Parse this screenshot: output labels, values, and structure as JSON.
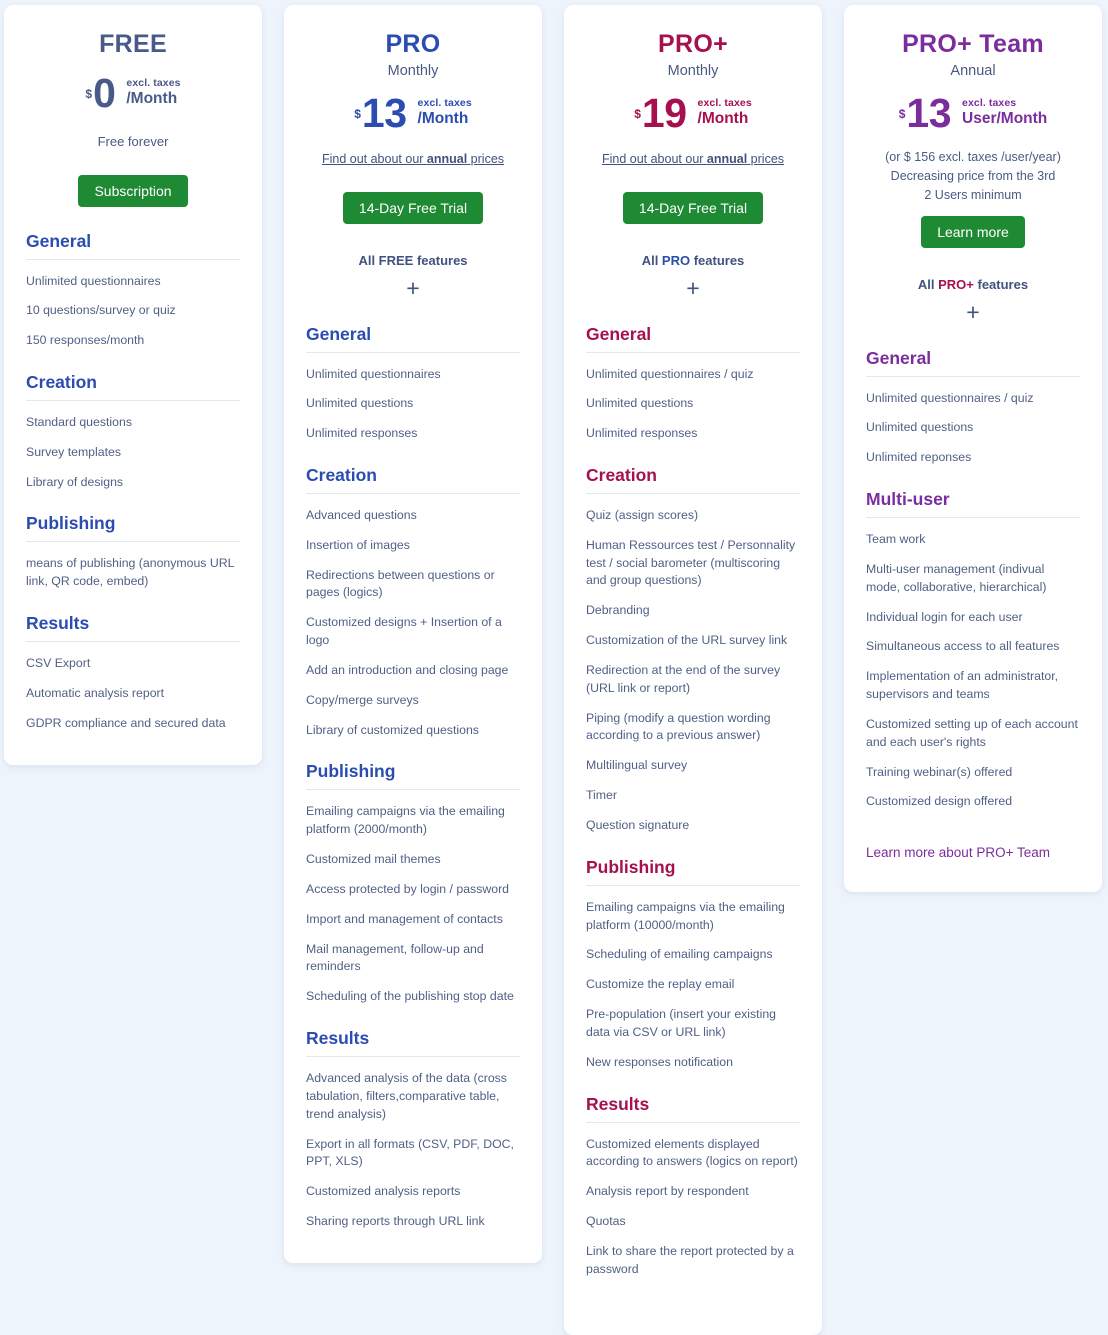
{
  "page": {
    "background": "#eef4fb",
    "card_background": "#ffffff",
    "body_text_color": "#505f85",
    "cta_green": "#1f8a34"
  },
  "plans": [
    {
      "id": "free",
      "name": "FREE",
      "period": "",
      "accent": "#4a5a88",
      "heading_color": "#2b4cb0",
      "price": {
        "currency": "$",
        "amount": "0",
        "tax_note": "excl. taxes",
        "per": "/Month"
      },
      "subnote": "Free forever",
      "cta_label": "Subscription",
      "sections": [
        {
          "title": "General",
          "items": [
            "Unlimited questionnaires",
            "10 questions/survey or quiz",
            "150 responses/month"
          ]
        },
        {
          "title": "Creation",
          "items": [
            "Standard questions",
            "Survey templates",
            "Library of designs"
          ]
        },
        {
          "title": "Publishing",
          "items": [
            "means of publishing (anonymous URL link, QR code, embed)"
          ]
        },
        {
          "title": "Results",
          "items": [
            "CSV Export",
            "Automatic analysis report",
            "GDPR compliance and secured data"
          ]
        }
      ]
    },
    {
      "id": "pro",
      "name": "PRO",
      "period": "Monthly",
      "accent": "#2b4cb0",
      "heading_color": "#2b4cb0",
      "price": {
        "currency": "$",
        "amount": "13",
        "tax_note": "excl. taxes",
        "per": "/Month"
      },
      "annual_link": {
        "before": "Find out about our ",
        "bold": "annual",
        "after": " prices"
      },
      "cta_label": "14-Day Free Trial",
      "includes": {
        "prefix": "All ",
        "highlight": "FREE",
        "suffix": " features",
        "highlight_color": "#41527e"
      },
      "plus": "+",
      "sections": [
        {
          "title": "General",
          "items": [
            "Unlimited questionnaires",
            "Unlimited questions",
            "Unlimited responses"
          ]
        },
        {
          "title": "Creation",
          "items": [
            "Advanced questions",
            "Insertion of images",
            "Redirections between questions or pages (logics)",
            "Customized designs + Insertion of a logo",
            "Add an introduction and closing page",
            "Copy/merge surveys",
            "Library of customized questions"
          ]
        },
        {
          "title": "Publishing",
          "items": [
            "Emailing campaigns via the emailing platform (2000/month)",
            "Customized mail themes",
            "Access protected by login / password",
            "Import and management of contacts",
            "Mail management, follow-up and reminders",
            "Scheduling of the publishing stop date"
          ]
        },
        {
          "title": "Results",
          "items": [
            "Advanced analysis of the data (cross tabulation, filters,comparative table, trend analysis)",
            "Export in all formats (CSV, PDF, DOC, PPT, XLS)",
            "Customized analysis reports",
            "Sharing reports through URL link"
          ]
        }
      ]
    },
    {
      "id": "proplus",
      "name": "PRO+",
      "period": "Monthly",
      "accent": "#a6104f",
      "heading_color": "#a6104f",
      "price": {
        "currency": "$",
        "amount": "19",
        "tax_note": "excl. taxes",
        "per": "/Month"
      },
      "annual_link": {
        "before": "Find out about our ",
        "bold": "annual",
        "after": " prices"
      },
      "cta_label": "14-Day Free Trial",
      "includes": {
        "prefix": "All ",
        "highlight": "PRO",
        "suffix": " features",
        "highlight_color": "#2b4cb0"
      },
      "plus": "+",
      "sections": [
        {
          "title": "General",
          "items": [
            "Unlimited questionnaires / quiz",
            "Unlimited questions",
            "Unlimited responses"
          ]
        },
        {
          "title": "Creation",
          "items": [
            "Quiz (assign scores)",
            "Human Ressources test / Personnality test / social barometer (multiscoring and group questions)",
            "Debranding",
            "Customization of the URL survey link",
            "Redirection at the end of the survey (URL link or report)",
            "Piping (modify a question wording according to a previous answer)",
            "Multilingual survey",
            "Timer",
            "Question signature"
          ]
        },
        {
          "title": "Publishing",
          "items": [
            "Emailing campaigns via the emailing platform (10000/month)",
            "Scheduling of emailing campaigns",
            "Customize the replay email",
            "Pre-population (insert your existing data via CSV or URL link)",
            "New responses notification"
          ]
        },
        {
          "title": "Results",
          "items": [
            "Customized elements displayed according to answers (logics on report)",
            "Analysis report by respondent",
            "Quotas",
            "Link to share the report protected by a password"
          ]
        }
      ]
    },
    {
      "id": "proplusteam",
      "name": "PRO+ Team",
      "period": "Annual",
      "accent": "#7b2d9e",
      "heading_color": "#7b2d9e",
      "price": {
        "currency": "$",
        "amount": "13",
        "tax_note": "excl. taxes",
        "per": "User/Month"
      },
      "notes": [
        "(or $ 156 excl. taxes /user/year)",
        "Decreasing price from the 3rd",
        "2 Users minimum"
      ],
      "cta_label": "Learn more",
      "includes": {
        "prefix": "All ",
        "highlight": "PRO+",
        "suffix": " features",
        "highlight_color": "#a6104f"
      },
      "plus": "+",
      "sections": [
        {
          "title": "General",
          "items": [
            "Unlimited questionnaires / quiz",
            "Unlimited questions",
            "Unlimited reponses"
          ]
        },
        {
          "title": "Multi-user",
          "items": [
            "Team work",
            "Multi-user management (indivual mode, collaborative, hierarchical)",
            "Individual login for each user",
            "Simultaneous access to all features",
            "Implementation of an administrator, supervisors and teams",
            "Customized setting up of each account and each user's rights",
            "Training webinar(s) offered",
            "Customized design offered"
          ]
        }
      ],
      "footer_link": "Learn more about PRO+ Team"
    }
  ]
}
